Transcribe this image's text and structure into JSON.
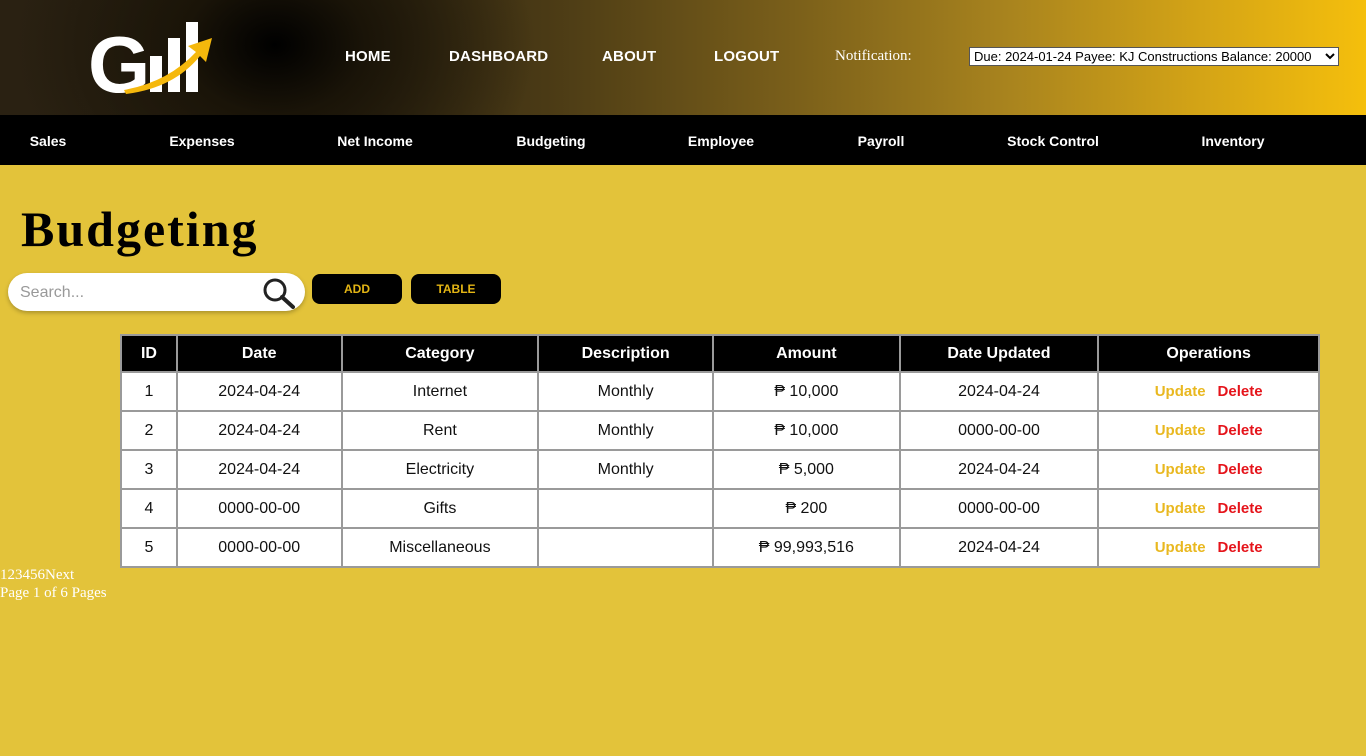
{
  "header": {
    "nav": [
      "HOME",
      "DASHBOARD",
      "ABOUT",
      "LOGOUT"
    ],
    "notification_label": "Notification:",
    "notification_selected": "Due: 2024-01-24 Payee: KJ Constructions Balance: 20000"
  },
  "subnav": [
    "Sales",
    "Expenses",
    "Net Income",
    "Budgeting",
    "Employee",
    "Payroll",
    "Stock Control",
    "Inventory"
  ],
  "page": {
    "title": "Budgeting",
    "search_placeholder": "Search...",
    "add_label": "ADD",
    "table_label": "TABLE"
  },
  "table": {
    "columns": [
      "ID",
      "Date",
      "Category",
      "Description",
      "Amount",
      "Date Updated",
      "Operations"
    ],
    "rows": [
      {
        "id": "1",
        "date": "2024-04-24",
        "category": "Internet",
        "description": "Monthly",
        "amount": "₱ 10,000",
        "updated": "2024-04-24"
      },
      {
        "id": "2",
        "date": "2024-04-24",
        "category": "Rent",
        "description": "Monthly",
        "amount": "₱ 10,000",
        "updated": "0000-00-00"
      },
      {
        "id": "3",
        "date": "2024-04-24",
        "category": "Electricity",
        "description": "Monthly",
        "amount": "₱ 5,000",
        "updated": "2024-04-24"
      },
      {
        "id": "4",
        "date": "0000-00-00",
        "category": "Gifts",
        "description": "",
        "amount": "₱ 200",
        "updated": "0000-00-00"
      },
      {
        "id": "5",
        "date": "0000-00-00",
        "category": "Miscellaneous",
        "description": "",
        "amount": "₱ 99,993,516",
        "updated": "2024-04-24"
      }
    ],
    "op_update": "Update",
    "op_delete": "Delete"
  },
  "pagination": {
    "pages": [
      "1",
      "2",
      "3",
      "4",
      "5",
      "6"
    ],
    "next": "Next",
    "summary": "Page 1 of 6 Pages"
  }
}
